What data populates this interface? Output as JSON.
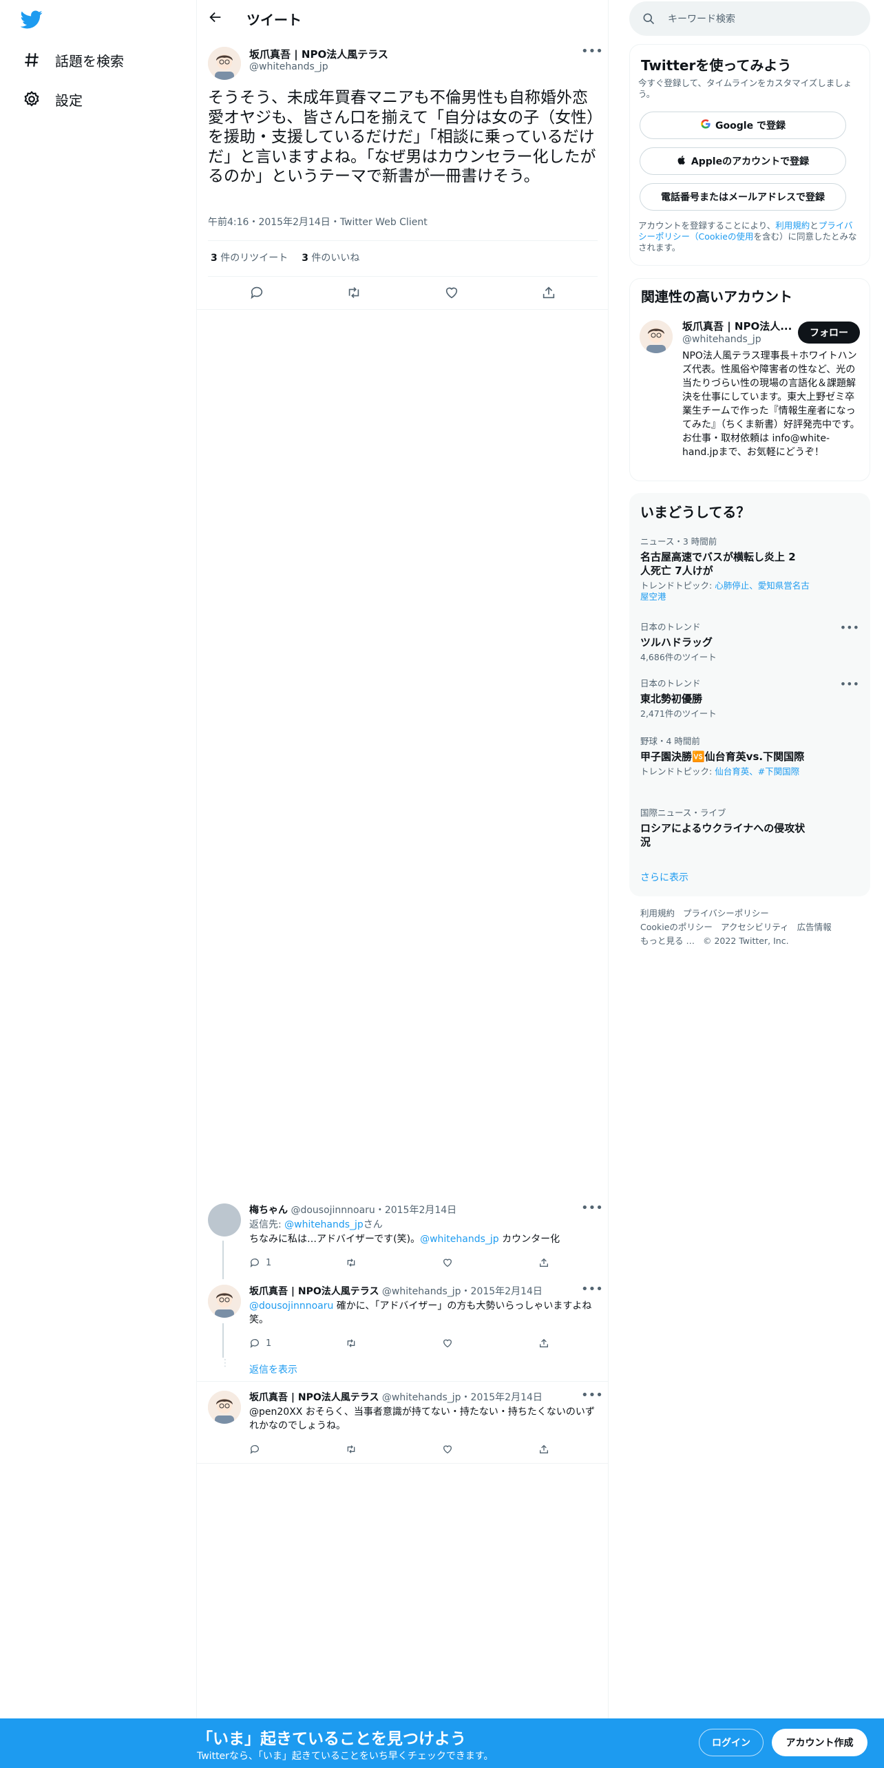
{
  "nav": {
    "explore_label": "話題を検索",
    "settings_label": "設定"
  },
  "header": {
    "title": "ツイート"
  },
  "tweet": {
    "name": "坂爪真吾 | NPO法人風テラス",
    "handle": "@whitehands_jp",
    "text": "そうそう、未成年買春マニアも不倫男性も自称婚外恋愛オヤジも、皆さん口を揃えて「自分は女の子（女性）を援助・支援しているだけだ」「相談に乗っているだけだ」と言いますよね。「なぜ男はカウンセラー化したがるのか」というテーマで新書が一冊書けそう。",
    "time": "午前4:16",
    "date": "2015年2月14日",
    "client": "Twitter Web Client",
    "retweet_count": "3",
    "retweet_label": "件のリツイート",
    "like_count": "3",
    "like_label": "件のいいね"
  },
  "replies": [
    {
      "name": "梅ちゃん",
      "handle": "@dousojinnnoaru",
      "date": "2015年2月14日",
      "reply_to_prefix": "返信先: ",
      "reply_to": "@whitehands_jp",
      "reply_to_suffix": "さん",
      "text_before": "ちなみに私は…アドバイザーです(笑)。",
      "mention": "@whitehands_jp",
      "text_after": " カウンター化",
      "reply_count": "1"
    },
    {
      "name": "坂爪真吾 | NPO法人風テラス",
      "handle": "@whitehands_jp",
      "date": "2015年2月14日",
      "mention": "@dousojinnnoaru",
      "text_after": " 確かに、「アドバイザー」の方も大勢いらっしゃいますよね笑。",
      "reply_count": "1"
    },
    {
      "name": "坂爪真吾 | NPO法人風テラス",
      "handle": "@whitehands_jp",
      "date": "2015年2月14日",
      "text": "@pen20XX おそらく、当事者意識が持てない・持たない・持ちたくないのいずれかなのでしょうね。"
    }
  ],
  "show_replies": "返信を表示",
  "search": {
    "placeholder": "キーワード検索"
  },
  "signup_card": {
    "title": "Twitterを使ってみよう",
    "subtitle": "今すぐ登録して、タイムラインをカスタマイズしましょう。",
    "google_label": "Google で登録",
    "apple_label": "Appleのアカウントで登録",
    "phone_label": "電話番号またはメールアドレスで登録",
    "legal_prefix": "アカウントを登録することにより、",
    "terms": "利用規約",
    "and": "と",
    "privacy": "プライバシーポリシー",
    "cookie": "（Cookieの使用",
    "legal_suffix": "を含む）に同意したとみなされます。"
  },
  "related": {
    "title": "関連性の高いアカウント",
    "name": "坂爪真吾 | NPO法人...",
    "handle": "@whitehands_jp",
    "follow_label": "フォロー",
    "bio": "NPO法人風テラス理事長＋ホワイトハンズ代表。性風俗や障害者の性など、光の当たりづらい性の現場の言語化＆課題解決を仕事にしています。東大上野ゼミ卒業生チームで作った『情報生産者になってみた』（ちくま新書）好評発売中です。 お仕事・取材依頼は info@white-hand.jpまで、お気軽にどうぞ！"
  },
  "trends": {
    "title": "いまどうしてる？",
    "items": [
      {
        "category": "ニュース・3 時間前",
        "title": "名古屋高速でバスが横転し炎上 2人死亡 7人けが",
        "topic_prefix": "トレンドトピック: ",
        "topics": "心肺停止、愛知県営名古屋空港"
      },
      {
        "category": "日本のトレンド",
        "title": "ツルハドラッグ",
        "count": "4,686件のツイート"
      },
      {
        "category": "日本のトレンド",
        "title": "東北勢初優勝",
        "count": "2,471件のツイート"
      },
      {
        "category": "野球・4 時間前",
        "title": "甲子園決勝🆚仙台育英vs.下関国際",
        "topic_prefix": "トレンドトピック: ",
        "topics": "仙台育英、#下関国際"
      },
      {
        "category": "国際ニュース・ライブ",
        "title": "ロシアによるウクライナへの侵攻状況"
      }
    ],
    "show_more": "さらに表示"
  },
  "footer": {
    "terms": "利用規約",
    "privacy": "プライバシーポリシー",
    "cookie": "Cookieのポリシー",
    "accessibility": "アクセシビリティ",
    "ads": "広告情報",
    "more": "もっと見る …",
    "copyright": "© 2022 Twitter, Inc."
  },
  "bottom_bar": {
    "title": "「いま」起きていることを見つけよう",
    "subtitle": "Twitterなら、「いま」起きていることをいち早くチェックできます。",
    "login_label": "ログイン",
    "signup_label": "アカウント作成"
  },
  "colors": {
    "accent": "#1d9bf0",
    "text": "#0f1419",
    "muted": "#536471"
  }
}
